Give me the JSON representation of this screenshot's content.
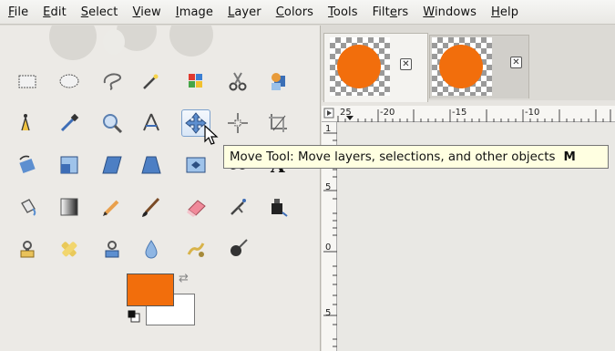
{
  "menubar": {
    "items": [
      {
        "pre": "",
        "u": "F",
        "post": "ile"
      },
      {
        "pre": "",
        "u": "E",
        "post": "dit"
      },
      {
        "pre": "",
        "u": "S",
        "post": "elect"
      },
      {
        "pre": "",
        "u": "V",
        "post": "iew"
      },
      {
        "pre": "",
        "u": "I",
        "post": "mage"
      },
      {
        "pre": "",
        "u": "L",
        "post": "ayer"
      },
      {
        "pre": "",
        "u": "C",
        "post": "olors"
      },
      {
        "pre": "",
        "u": "T",
        "post": "ools"
      },
      {
        "pre": "Filt",
        "u": "e",
        "post": "rs"
      },
      {
        "pre": "",
        "u": "W",
        "post": "indows"
      },
      {
        "pre": "",
        "u": "H",
        "post": "elp"
      }
    ]
  },
  "tools": [
    "rect-select-icon",
    "ellipse-select-icon",
    "free-select-icon",
    "fuzzy-select-icon",
    "color-select-icon",
    "scissors-select-icon",
    "foreground-select-icon",
    "paths-icon",
    "color-picker-icon",
    "magnify-icon",
    "measure-icon",
    "move-icon",
    "align-icon",
    "crop-icon",
    "rotate-icon",
    "scale-icon",
    "shear-icon",
    "perspective-icon",
    "flip-icon",
    "cage-icon",
    "text-icon",
    "bucket-fill-icon",
    "blend-icon",
    "pencil-icon",
    "paintbrush-icon",
    "eraser-icon",
    "airbrush-icon",
    "ink-icon",
    "clone-icon",
    "heal-icon",
    "perspective-clone-icon",
    "blur-icon",
    "smudge-icon",
    "dodge-burn-icon"
  ],
  "colors": {
    "foreground": "#f26e0c",
    "background": "#ffffff"
  },
  "image_tabs": [
    {
      "active": true,
      "close_icon": "close-icon"
    },
    {
      "active": false,
      "close_icon": "close-icon"
    }
  ],
  "ruler": {
    "h_labels": [
      "25",
      "-20",
      "-15",
      "-10"
    ],
    "v_labels": [
      "1",
      "5",
      "0",
      "5"
    ]
  },
  "tooltip": {
    "text": "Move Tool: Move layers, selections, and other objects",
    "shortcut": "M"
  }
}
